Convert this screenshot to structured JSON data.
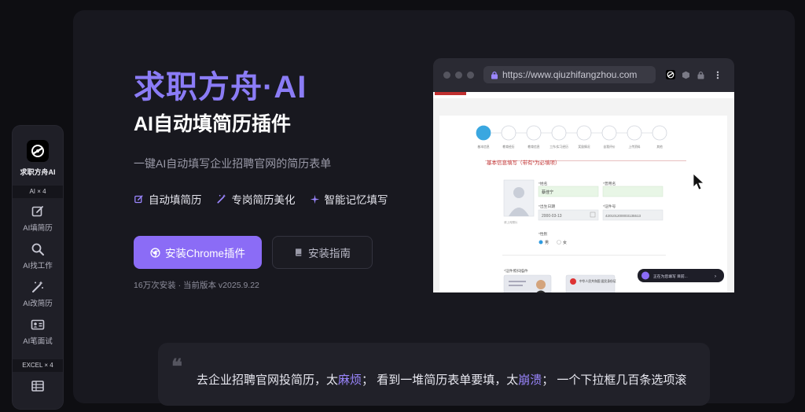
{
  "sidebar": {
    "logo_name": "求职方舟AI",
    "section_ai": "AI × 4",
    "items": [
      {
        "label": "AI填简历",
        "icon": "edit-icon"
      },
      {
        "label": "AI找工作",
        "icon": "search-icon"
      },
      {
        "label": "AI改简历",
        "icon": "magic-wand-icon"
      },
      {
        "label": "AI笔面试",
        "icon": "id-card-icon"
      }
    ],
    "section_excel": "EXCEL × 4",
    "excel_icon": "table-icon"
  },
  "hero": {
    "title": "求职方舟·AI",
    "subtitle": "AI自动填简历插件",
    "description": "一键AI自动填写企业招聘官网的简历表单",
    "features": [
      {
        "label": "自动填简历",
        "icon": "edit-icon"
      },
      {
        "label": "专岗简历美化",
        "icon": "magic-wand-icon"
      },
      {
        "label": "智能记忆填写",
        "icon": "sparkle-icon"
      }
    ],
    "primary_button": "安装Chrome插件",
    "secondary_button": "安装指南",
    "meta": "16万次安装 · 当前版本 v2025.9.22"
  },
  "browser": {
    "url": "https://www.qiuzhifangzhou.com",
    "form": {
      "steps": [
        "基本信息",
        "教育经历",
        "教育信息",
        "工作/实习经历",
        "奖励情况",
        "自我评价",
        "上传资料",
        "其他"
      ],
      "section_title": "基本信息填写（带有*为必填项）",
      "fields": [
        {
          "label": "*姓名",
          "value": "蔡佳宁"
        },
        {
          "label": "*曾用名",
          "value": ""
        },
        {
          "label": "*出生日期",
          "value": "2000-03-13"
        },
        {
          "label": "*证件号",
          "value": "420101200003135513"
        }
      ],
      "gender_label": "*性别",
      "gender_options": [
        "男",
        "女"
      ],
      "photo_note": "请上传照片",
      "id_section": "*证件照扫描件",
      "id_card_text": "中华人民共和国 居民身份证",
      "popup_text": "正在为您填写 目前..."
    }
  },
  "quote": {
    "mark": "❝",
    "text_before": "去企业招聘官网投简历，太",
    "hl1": "麻烦",
    "text_mid": "； 看到一堆简历表单要填，太",
    "hl2": "崩溃",
    "text_after": "； 一个下拉框几百条选项滚"
  },
  "colors": {
    "accent": "#8b6cf6",
    "title": "#8b7cf6",
    "background": "#18181f"
  }
}
